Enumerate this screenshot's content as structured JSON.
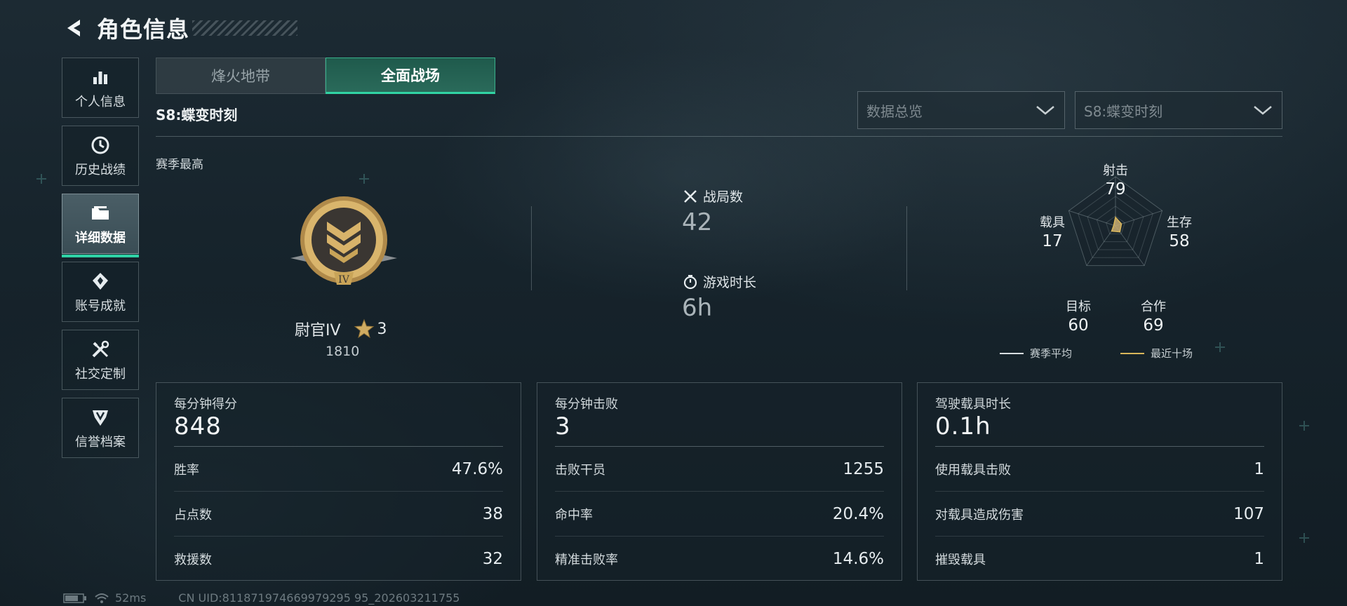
{
  "header": {
    "title": "角色信息"
  },
  "sidebar": {
    "items": [
      {
        "label": "个人信息",
        "icon": "bar-chart-icon"
      },
      {
        "label": "历史战绩",
        "icon": "history-clock-icon"
      },
      {
        "label": "详细数据",
        "icon": "folder-icon"
      },
      {
        "label": "账号成就",
        "icon": "achievement-medal-icon"
      },
      {
        "label": "社交定制",
        "icon": "tools-icon"
      },
      {
        "label": "信誉档案",
        "icon": "shield-badge-icon"
      }
    ],
    "active_index": 2
  },
  "tabs": [
    {
      "label": "烽火地带",
      "active": false
    },
    {
      "label": "全面战场",
      "active": true
    }
  ],
  "season": {
    "label": "S8:蝶变时刻"
  },
  "dropdowns": {
    "data_type": {
      "value": "数据总览"
    },
    "season": {
      "value": "S8:蝶变时刻"
    }
  },
  "best": {
    "label": "赛季最高",
    "rank_name": "尉官IV",
    "stars": "3",
    "score": "1810"
  },
  "stats": {
    "matches": {
      "label": "战局数",
      "value": "42"
    },
    "playtime": {
      "label": "游戏时长",
      "value": "6h"
    }
  },
  "radar": {
    "axes": [
      {
        "name": "射击",
        "value": "79"
      },
      {
        "name": "生存",
        "value": "58"
      },
      {
        "name": "合作",
        "value": "69"
      },
      {
        "name": "目标",
        "value": "60"
      },
      {
        "name": "载具",
        "value": "17"
      }
    ],
    "legend": [
      {
        "label": "赛季平均",
        "color": "#d9dfe2"
      },
      {
        "label": "最近十场",
        "color": "#d9b65a"
      }
    ],
    "recent_fill_color": "#c9ad72"
  },
  "cards": [
    {
      "title": "每分钟得分",
      "value": "848",
      "rows": [
        {
          "label": "胜率",
          "value": "47.6%"
        },
        {
          "label": "占点数",
          "value": "38"
        },
        {
          "label": "救援数",
          "value": "32"
        }
      ]
    },
    {
      "title": "每分钟击败",
      "value": "3",
      "rows": [
        {
          "label": "击败干员",
          "value": "1255"
        },
        {
          "label": "命中率",
          "value": "20.4%"
        },
        {
          "label": "精准击败率",
          "value": "14.6%"
        }
      ]
    },
    {
      "title": "驾驶载具时长",
      "value": "0.1h",
      "rows": [
        {
          "label": "使用载具击败",
          "value": "1"
        },
        {
          "label": "对载具造成伤害",
          "value": "107"
        },
        {
          "label": "摧毁载具",
          "value": "1"
        }
      ]
    }
  ],
  "footer": {
    "ping": "52ms",
    "uid": "CN UID:811871974669979295 95_202603211755"
  },
  "colors": {
    "accent": "#31d4a4",
    "gold": "#c9a458"
  }
}
